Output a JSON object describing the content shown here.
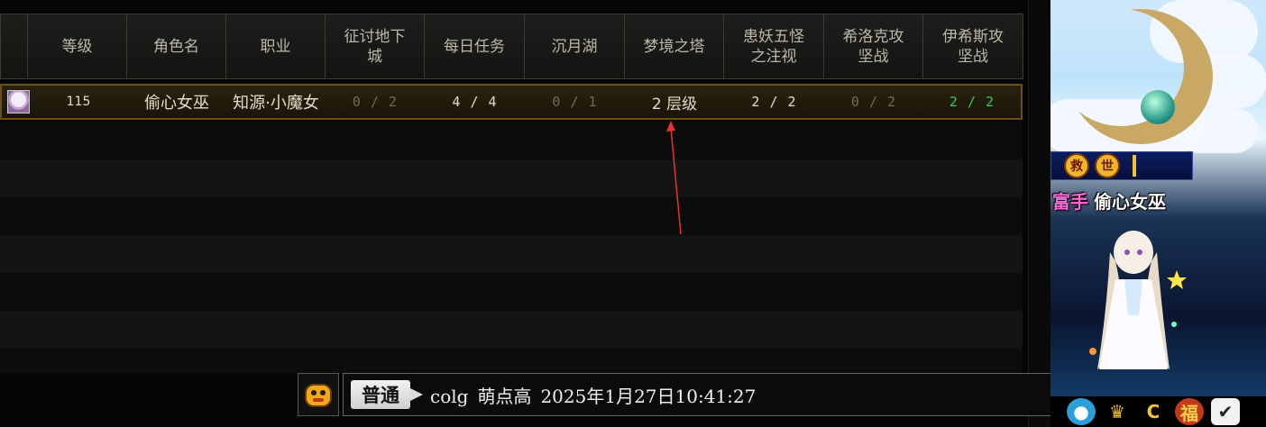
{
  "table": {
    "columns": [
      {
        "key": "portrait",
        "label": ""
      },
      {
        "key": "level",
        "label": "等级"
      },
      {
        "key": "name",
        "label": "角色名"
      },
      {
        "key": "class",
        "label": "职业"
      },
      {
        "key": "dungeon",
        "label": "征讨地下\n城"
      },
      {
        "key": "daily",
        "label": "每日任务"
      },
      {
        "key": "lake",
        "label": "沉月湖"
      },
      {
        "key": "tower",
        "label": "梦境之塔"
      },
      {
        "key": "fiends",
        "label": "患妖五怪\n之注视"
      },
      {
        "key": "hilock",
        "label": "希洛克攻\n坚战"
      },
      {
        "key": "isys",
        "label": "伊希斯攻\n坚战"
      }
    ],
    "rows": [
      {
        "level": "115",
        "name": "偷心女巫",
        "class": "知源·小魔女",
        "dungeon": "0 / 2",
        "daily": "4 / 4",
        "lake": "0 / 1",
        "tower": "2 层级",
        "fiends": "2 / 2",
        "hilock": "0 / 2",
        "isys": "2 / 2"
      }
    ]
  },
  "chat": {
    "channel": "普通",
    "sender": "colg",
    "nickname": "萌点高",
    "timestamp": "2025年1月27日10:41:27"
  },
  "character_panel": {
    "guild_seal_1": "救",
    "guild_seal_2": "世",
    "title": "富手",
    "player_name": "偷心女巫"
  },
  "icons": {
    "chat_icon": "gold-mascot-icon",
    "bottom": [
      "fish-icon",
      "crown-icon",
      "c-coin-icon",
      "fortune-bag-icon",
      "checklist-icon"
    ]
  },
  "colors": {
    "completed_green": "#33d04a",
    "row_highlight_border": "#6d4e15",
    "annotation_arrow": "#e8322e"
  }
}
